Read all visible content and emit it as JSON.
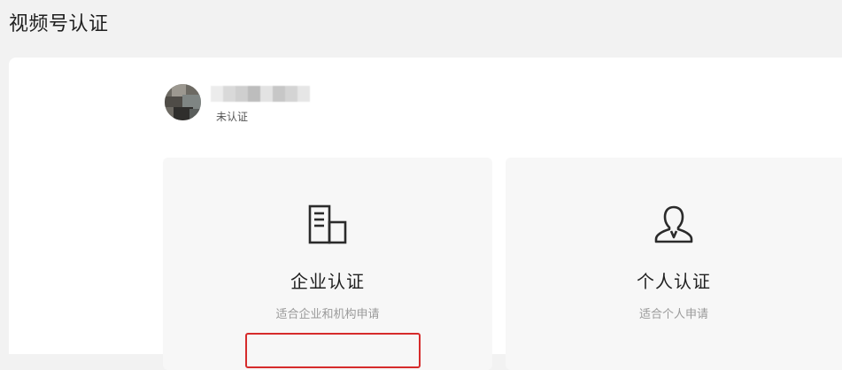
{
  "header": {
    "title": "视频号认证"
  },
  "account": {
    "status": "未认证",
    "avatar_icon": "avatar-image",
    "nickname_blur_colors": [
      "#ececec",
      "#d9d9d9",
      "#cfcfcf",
      "#bdbdbd",
      "#e3e3e3",
      "#c7c7c7",
      "#d4d4d4",
      "#e6e6e6"
    ]
  },
  "cards": [
    {
      "icon": "building-icon",
      "title": "企业认证",
      "description": "适合企业和机构申请"
    },
    {
      "icon": "person-icon",
      "title": "个人认证",
      "description": "适合个人申请"
    }
  ],
  "colors": {
    "page_bg": "#f2f2f2",
    "panel_bg": "#ffffff",
    "card_bg": "#f7f7f7",
    "highlight": "#d62b2b"
  }
}
